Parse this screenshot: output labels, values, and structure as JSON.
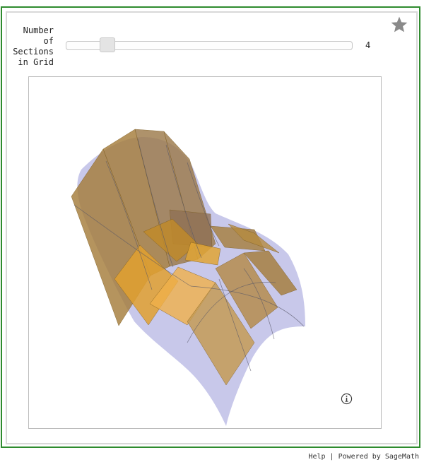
{
  "slider": {
    "label": "Number\nof\nSections\nin Grid",
    "value": "4",
    "fraction": 0.14
  },
  "icons": {
    "favorite": "star-icon",
    "info": "info-icon"
  },
  "footer": {
    "help": "Help",
    "separator": "|",
    "powered": "Powered by SageMath"
  },
  "colors": {
    "frame": "#2e8b2e",
    "surface": "#c8c8ea",
    "tangent_planes": "#d4a043"
  }
}
